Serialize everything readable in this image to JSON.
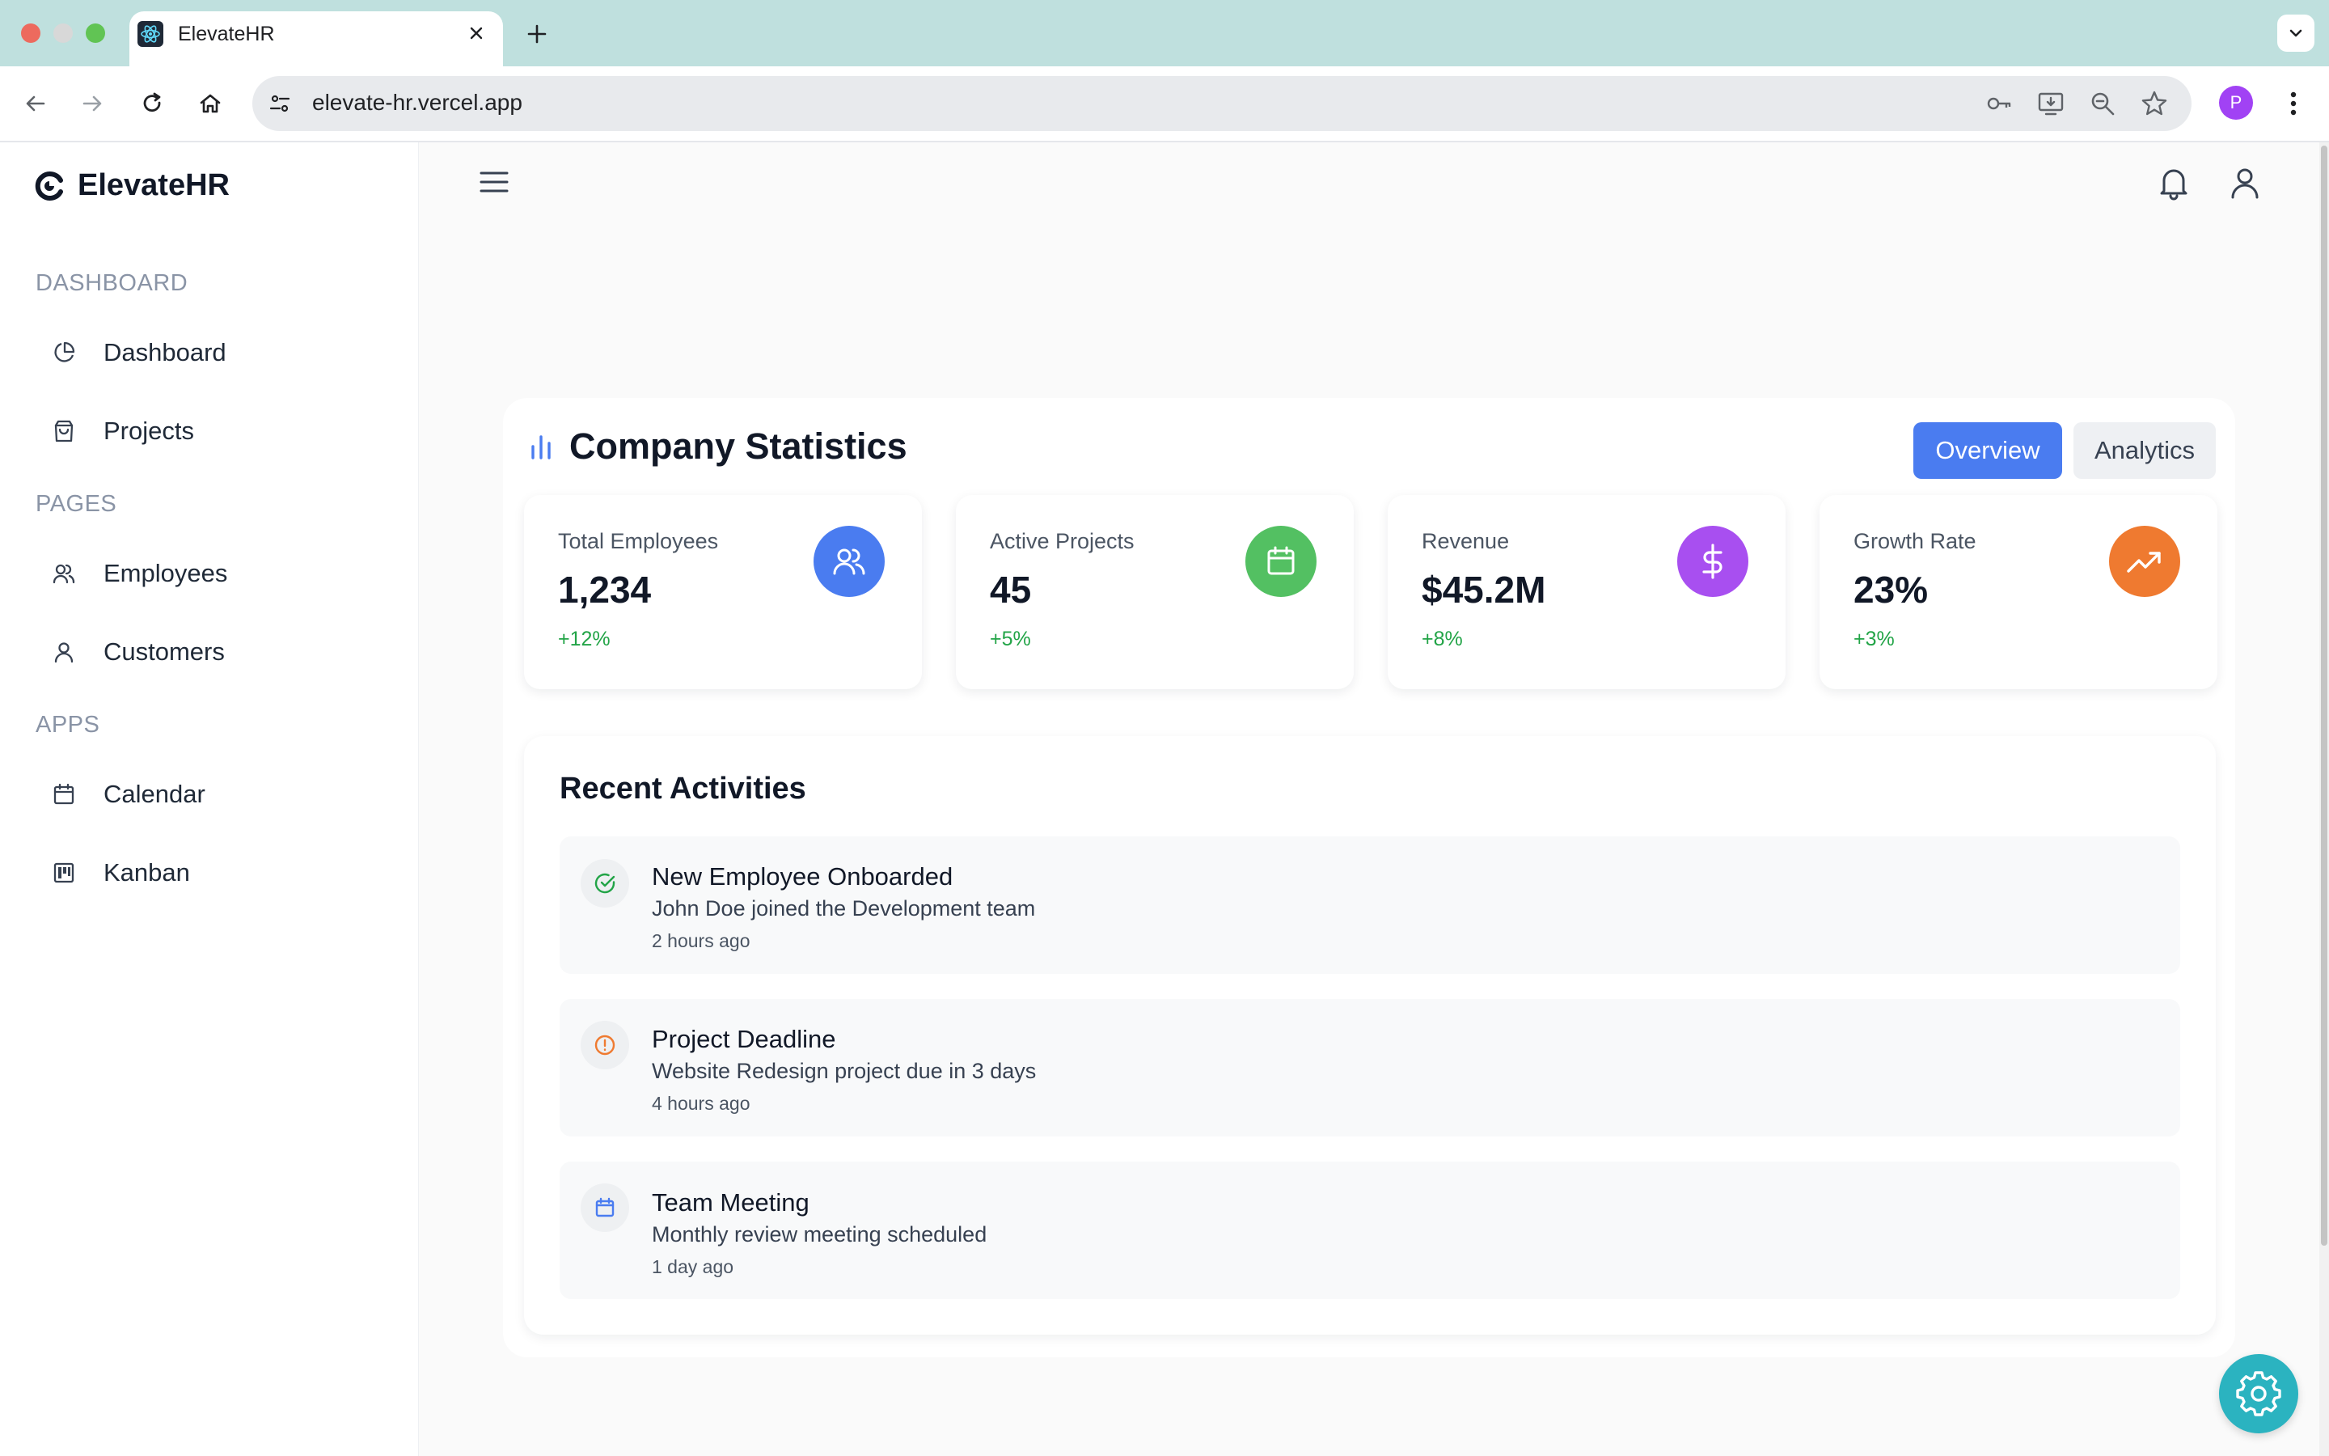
{
  "browser": {
    "tab_title": "ElevateHR",
    "url": "elevate-hr.vercel.app",
    "profile_initial": "P"
  },
  "app": {
    "brand": "ElevateHR"
  },
  "sidebar": {
    "sections": [
      {
        "label": "DASHBOARD",
        "items": [
          {
            "label": "Dashboard",
            "icon": "pie-chart-icon"
          },
          {
            "label": "Projects",
            "icon": "shopping-bag-icon"
          }
        ]
      },
      {
        "label": "PAGES",
        "items": [
          {
            "label": "Employees",
            "icon": "users-icon"
          },
          {
            "label": "Customers",
            "icon": "user-icon"
          }
        ]
      },
      {
        "label": "APPS",
        "items": [
          {
            "label": "Calendar",
            "icon": "calendar-icon"
          },
          {
            "label": "Kanban",
            "icon": "kanban-icon"
          }
        ]
      }
    ]
  },
  "stats": {
    "title": "Company Statistics",
    "tabs": {
      "overview": "Overview",
      "analytics": "Analytics"
    },
    "active_tab": "Overview",
    "cards": [
      {
        "label": "Total Employees",
        "value": "1,234",
        "delta": "+12%",
        "icon": "users-icon",
        "color": "#4a7cf0"
      },
      {
        "label": "Active Projects",
        "value": "45",
        "delta": "+5%",
        "icon": "calendar-icon",
        "color": "#53c062"
      },
      {
        "label": "Revenue",
        "value": "$45.2M",
        "delta": "+8%",
        "icon": "dollar-icon",
        "color": "#a84ff0"
      },
      {
        "label": "Growth Rate",
        "value": "23%",
        "delta": "+3%",
        "icon": "trending-up-icon",
        "color": "#ef7a30"
      }
    ]
  },
  "activities": {
    "title": "Recent Activities",
    "items": [
      {
        "title": "New Employee Onboarded",
        "description": "John Doe joined the Development team",
        "time": "2 hours ago",
        "icon": "check-circle-icon",
        "color": "#22a447"
      },
      {
        "title": "Project Deadline",
        "description": "Website Redesign project due in 3 days",
        "time": "4 hours ago",
        "icon": "alert-circle-icon",
        "color": "#ef7a30"
      },
      {
        "title": "Team Meeting",
        "description": "Monthly review meeting scheduled",
        "time": "1 day ago",
        "icon": "calendar-icon",
        "color": "#4a7cf0"
      }
    ]
  },
  "colors": {
    "accent": "#4a7cf0",
    "positive": "#22a447",
    "fab": "#2bb3c0"
  }
}
